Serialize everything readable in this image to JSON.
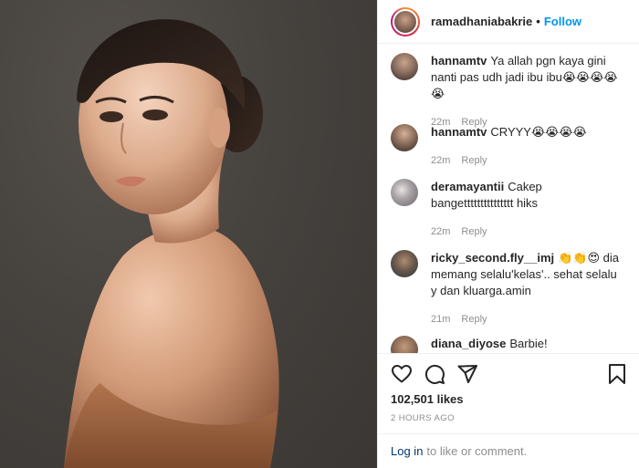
{
  "post": {
    "username": "ramadhaniabakrie",
    "separator": "•",
    "follow_label": "Follow",
    "likes": "102,501 likes",
    "timestamp": "2 HOURS AGO"
  },
  "comments": [
    {
      "user": "hannamtv",
      "text": "Ya allah pgn kaya gini nanti pas udh jadi ibu ibu😭😭😭😭😭",
      "age": "22m",
      "reply": "Reply"
    },
    {
      "user": "hannamtv",
      "text": "CRYYY😭😭😭😭",
      "age": "22m",
      "reply": "Reply"
    },
    {
      "user": "deramayantii",
      "text": "Cakep bangettttttttttttttt hiks",
      "age": "22m",
      "reply": "Reply"
    },
    {
      "user": "ricky_second.fly__imj",
      "text": "👏👏😍 dia memang selalu'kelas'.. sehat selalu y dan kluarga.amin",
      "age": "21m",
      "reply": "Reply"
    },
    {
      "user": "diana_diyose",
      "text": "Barbie!",
      "age": "",
      "reply": ""
    }
  ],
  "icons": {
    "like": "heart-icon",
    "comment": "comment-icon",
    "share": "share-icon",
    "save": "bookmark-icon"
  },
  "login": {
    "link": "Log in",
    "rest": "to like or comment."
  },
  "colors": {
    "follow": "#0095f6",
    "meta": "#8e8e8e",
    "login_link": "#00376b"
  }
}
